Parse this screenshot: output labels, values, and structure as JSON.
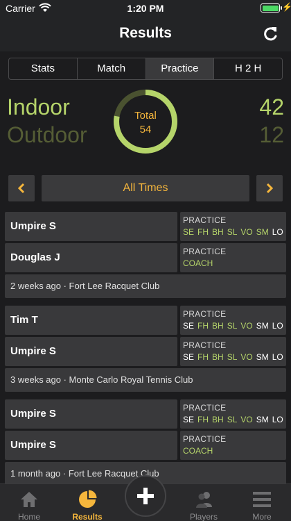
{
  "status": {
    "carrier": "Carrier",
    "time": "1:20 PM",
    "battery_level": 1.0
  },
  "nav": {
    "title": "Results"
  },
  "tabs": [
    {
      "label": "Stats",
      "active": false
    },
    {
      "label": "Match",
      "active": false
    },
    {
      "label": "Practice",
      "active": true
    },
    {
      "label": "H 2 H",
      "active": false
    }
  ],
  "summary": {
    "indoor_label": "Indoor",
    "outdoor_label": "Outdoor",
    "indoor_value": "42",
    "outdoor_value": "12",
    "total_label": "Total",
    "total_value": "54",
    "indoor_count": 42,
    "outdoor_count": 12
  },
  "period": {
    "label": "All Times"
  },
  "matches": [
    {
      "rows": [
        {
          "player": "Umpire S",
          "type": "PRACTICE",
          "skills": [
            {
              "label": "SE",
              "on": true
            },
            {
              "label": "FH",
              "on": true
            },
            {
              "label": "BH",
              "on": true
            },
            {
              "label": "SL",
              "on": true
            },
            {
              "label": "VO",
              "on": true
            },
            {
              "label": "SM",
              "on": true
            },
            {
              "label": "LO",
              "on": false
            }
          ]
        },
        {
          "player": "Douglas J",
          "type": "PRACTICE",
          "coach": "COACH"
        }
      ],
      "footer": "2 weeks ago · Fort Lee Racquet Club"
    },
    {
      "rows": [
        {
          "player": "Tim T",
          "type": "PRACTICE",
          "skills": [
            {
              "label": "SE",
              "on": false
            },
            {
              "label": "FH",
              "on": true
            },
            {
              "label": "BH",
              "on": true
            },
            {
              "label": "SL",
              "on": true
            },
            {
              "label": "VO",
              "on": true
            },
            {
              "label": "SM",
              "on": false
            },
            {
              "label": "LO",
              "on": false
            }
          ]
        },
        {
          "player": "Umpire S",
          "type": "PRACTICE",
          "skills": [
            {
              "label": "SE",
              "on": false
            },
            {
              "label": "FH",
              "on": true
            },
            {
              "label": "BH",
              "on": true
            },
            {
              "label": "SL",
              "on": true
            },
            {
              "label": "VO",
              "on": true
            },
            {
              "label": "SM",
              "on": false
            },
            {
              "label": "LO",
              "on": false
            }
          ]
        }
      ],
      "footer": "3 weeks ago · Monte Carlo Royal Tennis Club"
    },
    {
      "rows": [
        {
          "player": "Umpire S",
          "type": "PRACTICE",
          "skills": [
            {
              "label": "SE",
              "on": false
            },
            {
              "label": "FH",
              "on": true
            },
            {
              "label": "BH",
              "on": true
            },
            {
              "label": "SL",
              "on": true
            },
            {
              "label": "VO",
              "on": true
            },
            {
              "label": "SM",
              "on": false
            },
            {
              "label": "LO",
              "on": false
            }
          ]
        },
        {
          "player": "Umpire S",
          "type": "PRACTICE",
          "coach": "COACH"
        }
      ],
      "footer": "1 month ago · Fort Lee Racquet Club"
    }
  ],
  "tabbar": [
    {
      "label": "Home",
      "icon": "home-icon",
      "active": false
    },
    {
      "label": "Results",
      "icon": "pie-chart-icon",
      "active": true
    },
    {
      "label": "",
      "icon": "plus-icon",
      "active": false
    },
    {
      "label": "Players",
      "icon": "players-icon",
      "active": false
    },
    {
      "label": "More",
      "icon": "menu-icon",
      "active": false
    }
  ],
  "colors": {
    "accent": "#f5b63c",
    "indoor": "#b5d46a",
    "outdoor": "#555d35",
    "panel": "#39393b"
  }
}
